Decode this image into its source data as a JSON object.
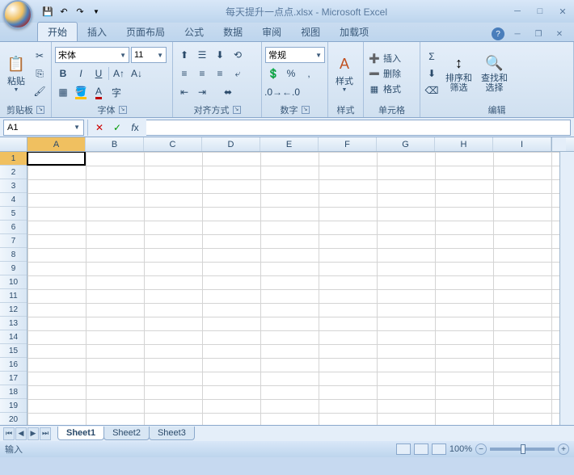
{
  "title": "每天提升一点点.xlsx - Microsoft Excel",
  "tabs": {
    "home": "开始",
    "insert": "插入",
    "layout": "页面布局",
    "formulas": "公式",
    "data": "数据",
    "review": "审阅",
    "view": "视图",
    "addins": "加载项"
  },
  "ribbon": {
    "clipboard": {
      "label": "剪贴板",
      "paste": "粘贴"
    },
    "font": {
      "label": "字体",
      "name": "宋体",
      "size": "11"
    },
    "align": {
      "label": "对齐方式"
    },
    "number": {
      "label": "数字",
      "format": "常规"
    },
    "styles": {
      "label": "样式",
      "btn": "样式"
    },
    "cells": {
      "label": "单元格",
      "insert": "插入",
      "delete": "删除",
      "format": "格式"
    },
    "editing": {
      "label": "编辑",
      "sort": "排序和\n筛选",
      "find": "查找和\n选择"
    }
  },
  "namebox": "A1",
  "columns": [
    "A",
    "B",
    "C",
    "D",
    "E",
    "F",
    "G",
    "H",
    "I"
  ],
  "rows": [
    "1",
    "2",
    "3",
    "4",
    "5",
    "6",
    "7",
    "8",
    "9",
    "10",
    "11",
    "12",
    "13",
    "14",
    "15",
    "16",
    "17",
    "18",
    "19",
    "20"
  ],
  "sheets": [
    "Sheet1",
    "Sheet2",
    "Sheet3"
  ],
  "status": {
    "mode": "输入",
    "zoom": "100%"
  }
}
